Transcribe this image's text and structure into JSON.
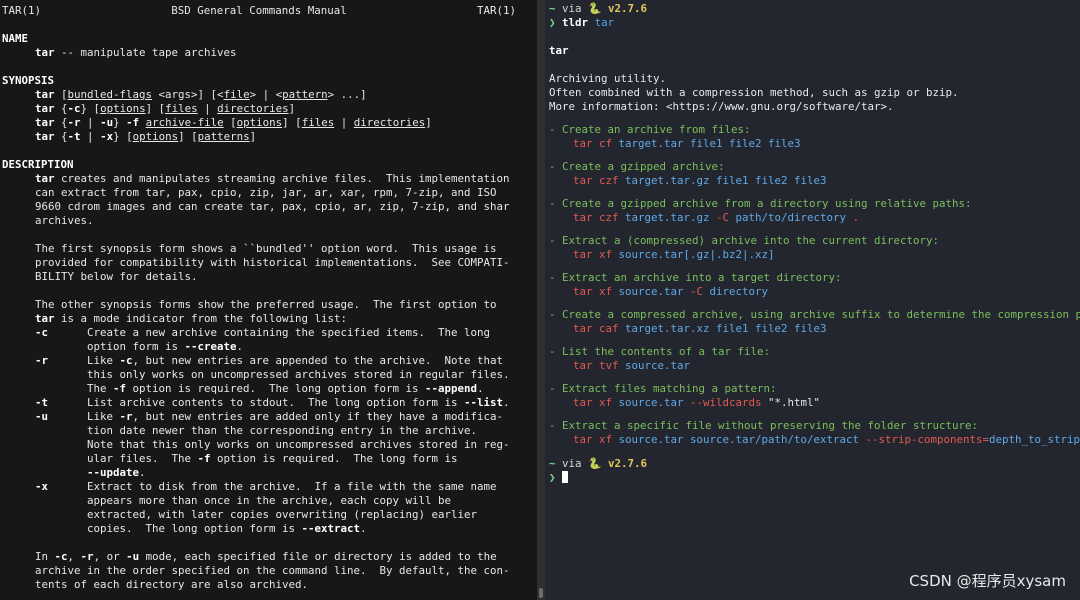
{
  "man": {
    "header_left": "TAR(1)",
    "header_center": "BSD General Commands Manual",
    "header_right": "TAR(1)",
    "name_heading": "NAME",
    "name_cmd": "tar",
    "name_desc": " -- manipulate tape archives",
    "synopsis_heading": "SYNOPSIS",
    "synopsis": {
      "l1": {
        "cmd": "tar",
        "a": "bundled-flags",
        "b": " <args>] [<",
        "c": "file",
        "d": "> | <",
        "e": "pattern",
        "f": "> ...]"
      },
      "l2": {
        "cmd": "tar",
        "a": " {",
        "b": "-c",
        "c": "} [",
        "d": "options",
        "e": "] [",
        "f": "files",
        "g": " | ",
        "h": "directories",
        "i": "]"
      },
      "l3": {
        "cmd": "tar",
        "a": " {",
        "b": "-r",
        "c": " | ",
        "d": "-u",
        "e": "} ",
        "f": "-f",
        "g": " ",
        "h": "archive-file",
        "i": " [",
        "j": "options",
        "k": "] [",
        "l": "files",
        "m": " | ",
        "n": "directories",
        "o": "]"
      },
      "l4": {
        "cmd": "tar",
        "a": " {",
        "b": "-t",
        "c": " | ",
        "d": "-x",
        "e": "} [",
        "f": "options",
        "g": "] [",
        "h": "patterns",
        "i": "]"
      }
    },
    "description_heading": "DESCRIPTION",
    "desc_p1_cmd": "tar",
    "desc_p1_l1": " creates and manipulates streaming archive files.  This implementation",
    "desc_p1_l2": "can extract from tar, pax, cpio, zip, jar, ar, xar, rpm, 7-zip, and ISO",
    "desc_p1_l3": "9660 cdrom images and can create tar, pax, cpio, ar, zip, 7-zip, and shar",
    "desc_p1_l4": "archives.",
    "desc_p2_l1": "The first synopsis form shows a ``bundled'' option word.  This usage is",
    "desc_p2_l2": "provided for compatibility with historical implementations.  See COMPATI-",
    "desc_p2_l3": "BILITY below for details.",
    "desc_p3_l1": "The other synopsis forms show the preferred usage.  The first option to",
    "desc_p3_l2_cmd": "tar",
    "desc_p3_l2": " is a mode indicator from the following list:",
    "opt_c": {
      "flag": "-c",
      "l1": "Create a new archive containing the specified items.  The long",
      "l2a": "option form is ",
      "l2b": "--create",
      "l2c": "."
    },
    "opt_r": {
      "flag": "-r",
      "l1a": "Like ",
      "l1b": "-c",
      "l1c": ", but new entries are appended to the archive.  Note that",
      "l2": "this only works on uncompressed archives stored in regular files.",
      "l3a": "The ",
      "l3b": "-f",
      "l3c": " option is required.  The long option form is ",
      "l3d": "--append",
      "l3e": "."
    },
    "opt_t": {
      "flag": "-t",
      "l1a": "List archive contents to stdout.  The long option form is ",
      "l1b": "--list",
      "l1c": "."
    },
    "opt_u": {
      "flag": "-u",
      "l1a": "Like ",
      "l1b": "-r",
      "l1c": ", but new entries are added only if they have a modifica-",
      "l2": "tion date newer than the corresponding entry in the archive.",
      "l3": "Note that this only works on uncompressed archives stored in reg-",
      "l4a": "ular files.  The ",
      "l4b": "-f",
      "l4c": " option is required.  The long form is",
      "l5a": "--update",
      "l5b": "."
    },
    "opt_x": {
      "flag": "-x",
      "l1": "Extract to disk from the archive.  If a file with the same name",
      "l2": "appears more than once in the archive, each copy will be",
      "l3": "extracted, with later copies overwriting (replacing) earlier",
      "l4a": "copies.  The long option form is ",
      "l4b": "--extract",
      "l4c": "."
    },
    "desc_p4_l1a": "In ",
    "desc_p4_l1b": "-c",
    "desc_p4_l1c": ", ",
    "desc_p4_l1d": "-r",
    "desc_p4_l1e": ", or ",
    "desc_p4_l1f": "-u",
    "desc_p4_l1g": " mode, each specified file or directory is added to the",
    "desc_p4_l2": "archive in the order specified on the command line.  By default, the con-",
    "desc_p4_l3": "tents of each directory are also archived."
  },
  "tldr": {
    "prompt_arrow": "❯",
    "via": "via",
    "snake_icon": "🐍",
    "version": "v2.7.6",
    "command": "tldr",
    "command_arg": "tar",
    "title": "tar",
    "intro_l1": "Archiving utility.",
    "intro_l2": "Often combined with a compression method, such as gzip or bzip.",
    "intro_l3": "More information: <https://www.gnu.org/software/tar>.",
    "examples": [
      {
        "desc": "- Create an archive from files:",
        "parts": [
          [
            "red",
            "tar cf "
          ],
          [
            "blue",
            "target.tar file1 file2 file3"
          ]
        ]
      },
      {
        "desc": "- Create a gzipped archive:",
        "parts": [
          [
            "red",
            "tar czf "
          ],
          [
            "blue",
            "target.tar.gz file1 file2 file3"
          ]
        ]
      },
      {
        "desc": "- Create a gzipped archive from a directory using relative paths:",
        "parts": [
          [
            "red",
            "tar czf "
          ],
          [
            "blue",
            "target.tar.gz "
          ],
          [
            "red",
            "-C "
          ],
          [
            "blue",
            "path/to/directory "
          ],
          [
            "red",
            "."
          ]
        ]
      },
      {
        "desc": "- Extract a (compressed) archive into the current directory:",
        "parts": [
          [
            "red",
            "tar xf "
          ],
          [
            "blue",
            "source.tar[.gz|.bz2|.xz]"
          ]
        ]
      },
      {
        "desc": "- Extract an archive into a target directory:",
        "parts": [
          [
            "red",
            "tar xf "
          ],
          [
            "blue",
            "source.tar "
          ],
          [
            "red",
            "-C "
          ],
          [
            "blue",
            "directory"
          ]
        ]
      },
      {
        "desc": "- Create a compressed archive, using archive suffix to determine the compression program:",
        "parts": [
          [
            "red",
            "tar caf "
          ],
          [
            "blue",
            "target.tar.xz file1 file2 file3"
          ]
        ]
      },
      {
        "desc": "- List the contents of a tar file:",
        "parts": [
          [
            "red",
            "tar tvf "
          ],
          [
            "blue",
            "source.tar"
          ]
        ]
      },
      {
        "desc": "- Extract files matching a pattern:",
        "parts": [
          [
            "red",
            "tar xf "
          ],
          [
            "blue",
            "source.tar "
          ],
          [
            "red",
            "--wildcards "
          ],
          [
            "plain",
            "\"*.html\""
          ]
        ]
      },
      {
        "desc": "- Extract a specific file without preserving the folder structure:",
        "parts": [
          [
            "red",
            "tar xf "
          ],
          [
            "blue",
            "source.tar source.tar/path/to/extract "
          ],
          [
            "red",
            "--strip-components="
          ],
          [
            "blue",
            "depth_to_strip"
          ]
        ]
      }
    ]
  },
  "watermark": "CSDN @程序员xysam",
  "colors": {
    "left_bg": "#171717",
    "right_bg": "#23262f",
    "green": "#7bbf5a",
    "red": "#e35a4f",
    "blue": "#5fa9e6",
    "yellow": "#e3c75a"
  }
}
